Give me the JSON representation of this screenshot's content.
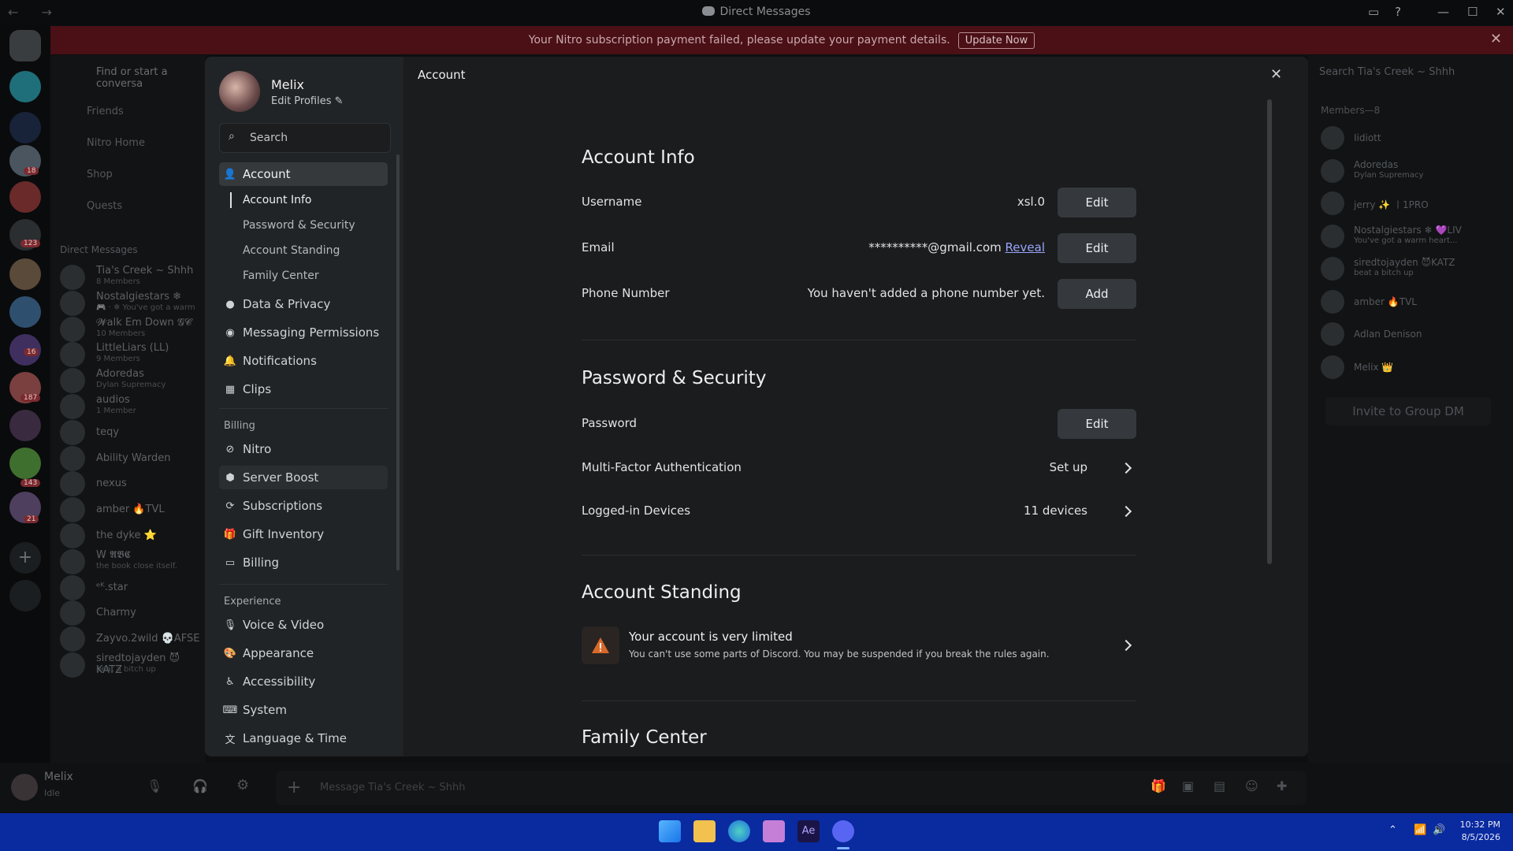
{
  "window": {
    "title": "Direct Messages",
    "nav": "← →"
  },
  "banner": {
    "text": "Your Nitro subscription payment failed, please update your payment details.",
    "button": "Update Now"
  },
  "channel_list": {
    "find": "Find or start a conversa",
    "nav": [
      "Friends",
      "Nitro Home",
      "Shop",
      "Quests"
    ],
    "dm_header": "Direct Messages",
    "dms": [
      {
        "name": "Tia's Creek ~ Shhh",
        "sub": "8 Members"
      },
      {
        "name": "Nostalgiestars ❄",
        "sub": "🎮 · ❄ You've got a warm"
      },
      {
        "name": "𝓦alk Em Down 𝓖𝓒",
        "sub": "10 Members"
      },
      {
        "name": "LittleLiars (LL)",
        "sub": "9 Members"
      },
      {
        "name": "Adoredas",
        "sub": "Dylan Supremacy"
      },
      {
        "name": "audios",
        "sub": "1 Member"
      },
      {
        "name": "teqy",
        "sub": ""
      },
      {
        "name": "Ability Warden",
        "sub": ""
      },
      {
        "name": "nexus",
        "sub": ""
      },
      {
        "name": "amber 🔥TVL",
        "sub": ""
      },
      {
        "name": "the dyke ⭐",
        "sub": ""
      },
      {
        "name": "W 𝕬𝕭𝕮",
        "sub": "the book close itself."
      },
      {
        "name": "ᵉᴷ.star",
        "sub": ""
      },
      {
        "name": "Charmy",
        "sub": ""
      },
      {
        "name": "Zayvo.2wild 💀AFSE",
        "sub": ""
      },
      {
        "name": "siredtojayden 😈KATZ",
        "sub": "beat a bitch up"
      }
    ]
  },
  "user_panel": {
    "name": "Melix",
    "status": "Idle"
  },
  "composer": {
    "placeholder": "Message Tia's Creek ~ Shhh"
  },
  "members_panel": {
    "search": "Search Tia's Creek ~ Shhh",
    "header": "Members—8",
    "members": [
      {
        "name": "Iidiott",
        "sub": ""
      },
      {
        "name": "Adoredas",
        "sub": "Dylan Supremacy"
      },
      {
        "name": "jerry ✨ 〡1PRO",
        "sub": ""
      },
      {
        "name": "Nostalgiestars ❄ 💜LIV",
        "sub": "You've got a warm heart..."
      },
      {
        "name": "siredtojayden 😈KATZ",
        "sub": "beat a bitch up"
      },
      {
        "name": "amber 🔥TVL",
        "sub": ""
      },
      {
        "name": "Adlan Denison",
        "sub": ""
      },
      {
        "name": "Melix 👑",
        "sub": ""
      }
    ],
    "invite": "Invite to Group DM"
  },
  "settings": {
    "profile": {
      "name": "Melix",
      "edit": "Edit Profiles"
    },
    "search_placeholder": "Search",
    "section_header": "Account",
    "sidebar": {
      "account": "Account",
      "subitems": [
        "Account Info",
        "Password & Security",
        "Account Standing",
        "Family Center"
      ],
      "items_a": [
        {
          "label": "Data & Privacy",
          "icon": "shield-icon"
        },
        {
          "label": "Messaging Permissions",
          "icon": "chat-lock-icon"
        },
        {
          "label": "Notifications",
          "icon": "bell-icon"
        },
        {
          "label": "Clips",
          "icon": "clips-icon"
        }
      ],
      "billing_head": "Billing",
      "items_b": [
        {
          "label": "Nitro",
          "icon": "nitro-icon"
        },
        {
          "label": "Server Boost",
          "icon": "boost-icon"
        },
        {
          "label": "Subscriptions",
          "icon": "subscriptions-icon"
        },
        {
          "label": "Gift Inventory",
          "icon": "gift-icon"
        },
        {
          "label": "Billing",
          "icon": "card-icon"
        }
      ],
      "experience_head": "Experience",
      "items_c": [
        {
          "label": "Voice & Video",
          "icon": "mic-icon"
        },
        {
          "label": "Appearance",
          "icon": "palette-icon"
        },
        {
          "label": "Accessibility",
          "icon": "accessibility-icon"
        },
        {
          "label": "System",
          "icon": "keyboard-icon"
        },
        {
          "label": "Language & Time",
          "icon": "translate-icon"
        }
      ]
    },
    "account_info": {
      "title": "Account Info",
      "username_label": "Username",
      "username_value": "xsl.0",
      "email_label": "Email",
      "email_value": "**********@gmail.com",
      "email_reveal": "Reveal",
      "phone_label": "Phone Number",
      "phone_value": "You haven't added a phone number yet.",
      "edit": "Edit",
      "add": "Add"
    },
    "password_security": {
      "title": "Password & Security",
      "password_label": "Password",
      "edit": "Edit",
      "mfa_label": "Multi-Factor Authentication",
      "mfa_value": "Set up",
      "devices_label": "Logged-in Devices",
      "devices_value": "11 devices"
    },
    "account_standing": {
      "title": "Account Standing",
      "headline": "Your account is very limited",
      "detail": "You can't use some parts of Discord. You may be suspended if you break the rules again."
    },
    "family_center": {
      "title": "Family Center"
    }
  },
  "taskbar": {
    "time": "10:32 PM",
    "date": "8/5/2026"
  },
  "colors": {
    "accent": "#5865f2",
    "banner": "#4a1016",
    "warning": "#c85a1e"
  }
}
